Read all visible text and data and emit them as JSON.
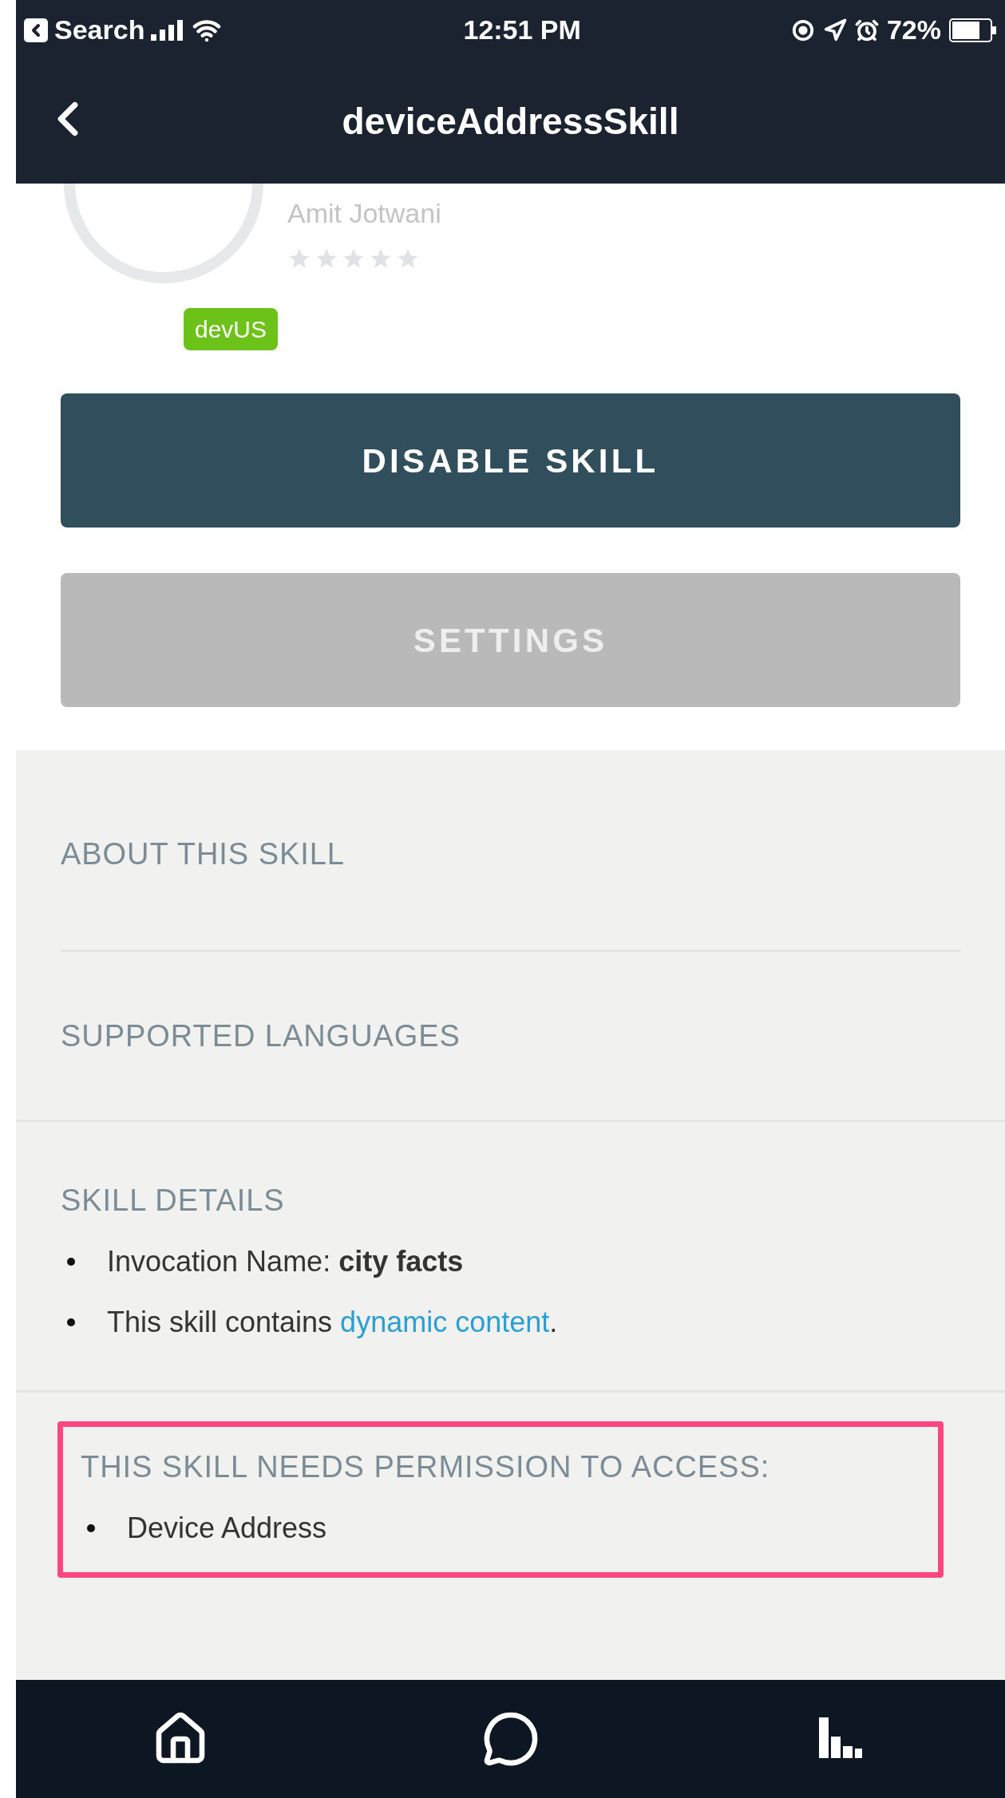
{
  "status_bar": {
    "back_app": "Search",
    "time": "12:51 PM",
    "battery": "72%"
  },
  "nav": {
    "title": "deviceAddressSkill"
  },
  "skill": {
    "developer": "Amit Jotwani",
    "rating": {
      "stars": 0
    },
    "badge": "devUS"
  },
  "buttons": [
    {
      "kind": "primary",
      "label": "DISABLE SKILL",
      "disabled": false
    },
    {
      "kind": "secondary",
      "label": "SETTINGS",
      "disabled": true
    }
  ],
  "sections": [
    {
      "kind": "heading",
      "title": "ABOUT THIS SKILL"
    },
    {
      "kind": "heading",
      "title": "SUPPORTED LANGUAGES"
    },
    {
      "kind": "list",
      "title": "SKILL DETAILS",
      "items": [
        {
          "text": "Invocation Name: **city facts**"
        },
        {
          "text": "This skill contains ",
          "link": "dynamic content",
          "after": "."
        }
      ]
    },
    {
      "kind": "list",
      "title": "THIS SKILL NEEDS PERMISSION TO ACCESS:",
      "highlighted": true,
      "items": [
        {
          "text": "Device Address"
        }
      ]
    }
  ],
  "tab_bar": [
    {
      "kind": "home",
      "selected": false
    },
    {
      "kind": "chat",
      "selected": false
    },
    {
      "kind": "activity",
      "selected": false
    }
  ]
}
